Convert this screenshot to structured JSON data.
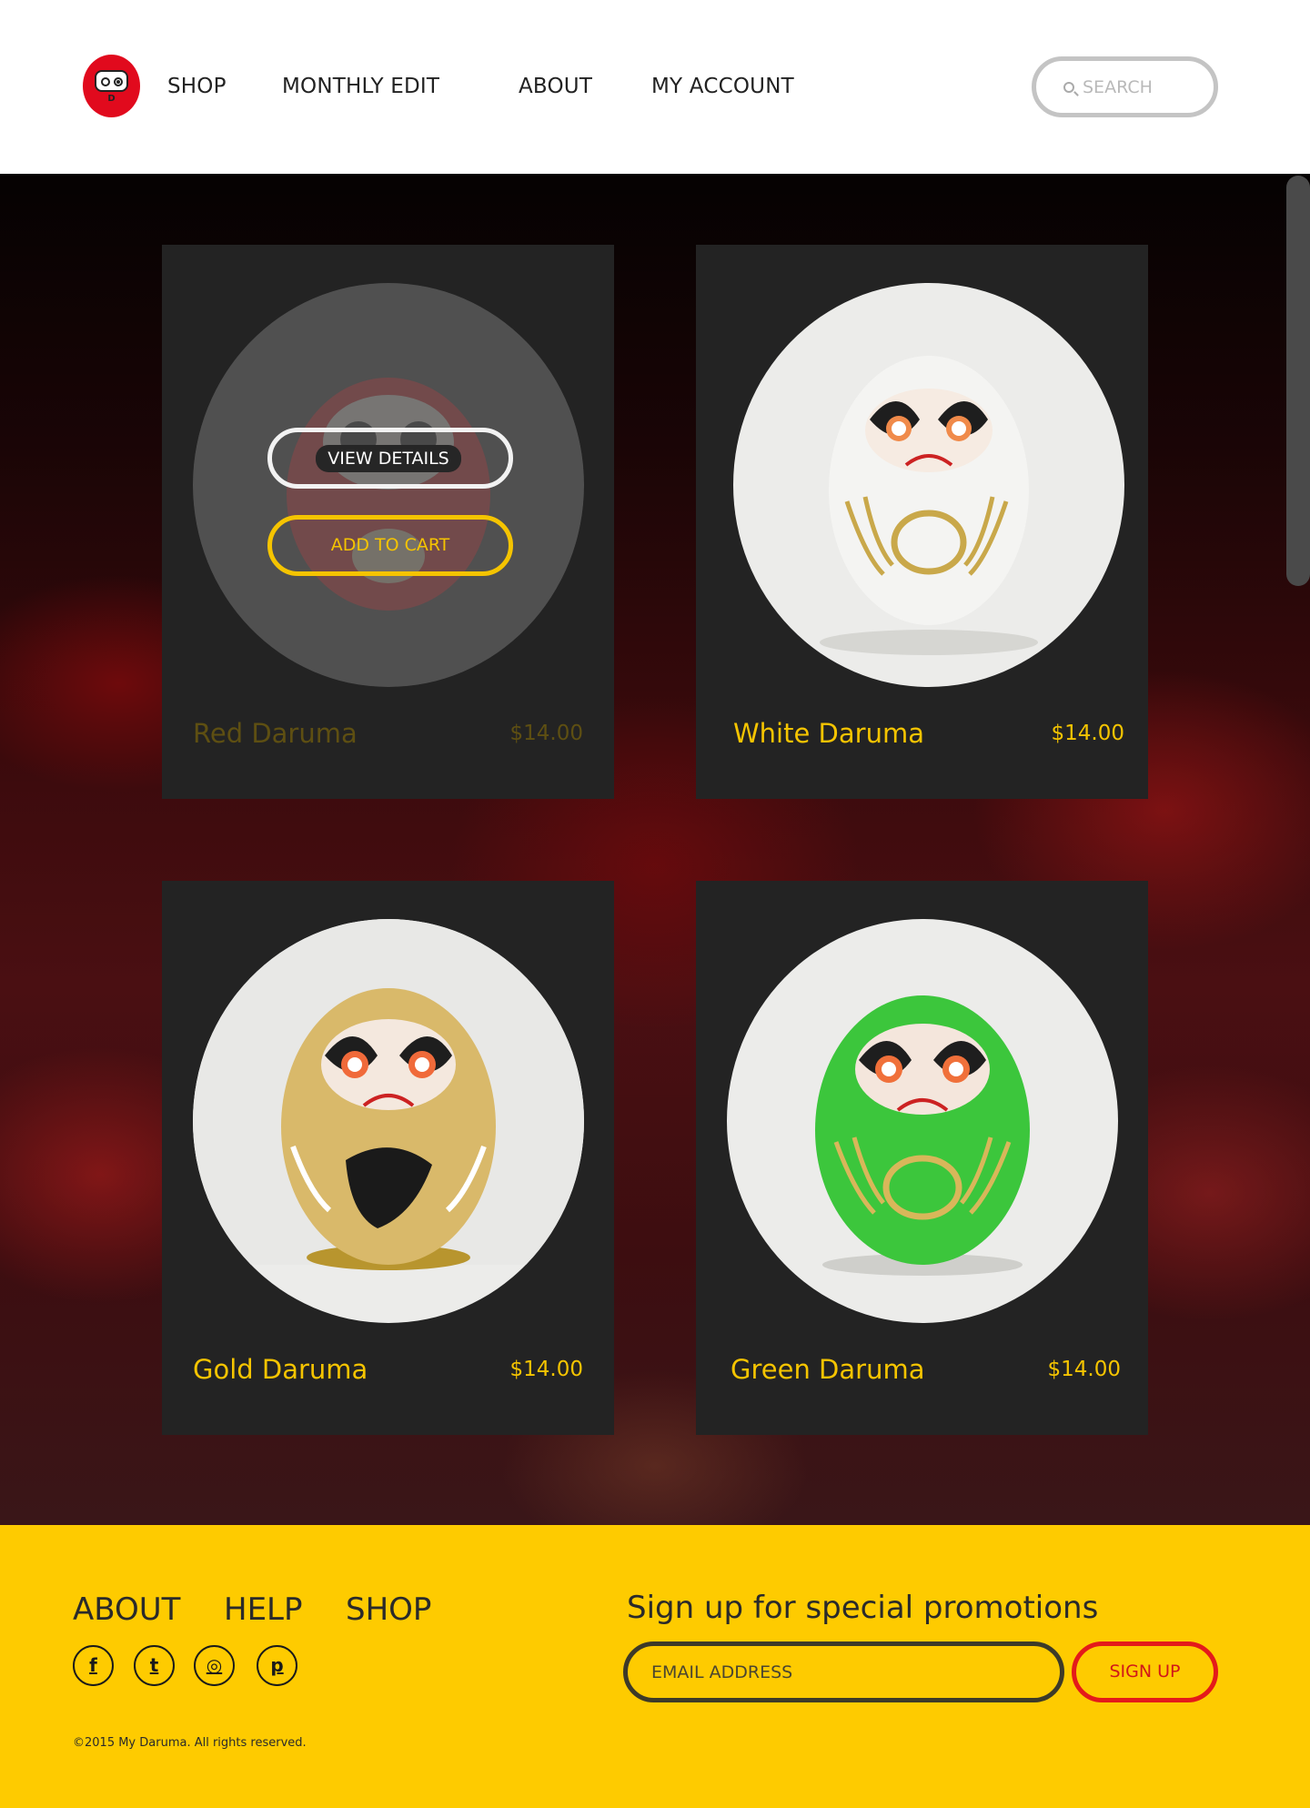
{
  "brand": {
    "logo_letter": "D",
    "accent_color": "#e10a1d"
  },
  "nav": {
    "items": [
      {
        "label": "SHOP"
      },
      {
        "label": "MONTHLY EDIT"
      },
      {
        "label": "ABOUT"
      },
      {
        "label": "MY ACCOUNT"
      }
    ]
  },
  "search": {
    "placeholder": "SEARCH",
    "icon": "search-icon"
  },
  "products": [
    {
      "name": "Red Daruma",
      "price": "$14.00",
      "body_color": "#d8262a",
      "hovered": true
    },
    {
      "name": "White Daruma",
      "price": "$14.00",
      "body_color": "#f4f4f2",
      "hovered": false
    },
    {
      "name": "Gold Daruma",
      "price": "$14.00",
      "body_color": "#d9b96a",
      "hovered": false
    },
    {
      "name": "Green Daruma",
      "price": "$14.00",
      "body_color": "#3cc63c",
      "hovered": false
    }
  ],
  "product_actions": {
    "view_details": "VIEW DETAILS",
    "add_to_cart": "ADD TO CART"
  },
  "footer": {
    "links": [
      {
        "label": "ABOUT"
      },
      {
        "label": "HELP"
      },
      {
        "label": "SHOP"
      }
    ],
    "social": [
      {
        "icon": "facebook-icon",
        "glyph": "f"
      },
      {
        "icon": "twitter-icon",
        "glyph": "t"
      },
      {
        "icon": "instagram-icon",
        "glyph": "◎"
      },
      {
        "icon": "pinterest-icon",
        "glyph": "p"
      }
    ],
    "promo_title": "Sign up for special promotions",
    "email_placeholder": "EMAIL ADDRESS",
    "signup_label": "SIGN UP",
    "copyright": "©2015 My Daruma. All rights reserved.",
    "background": "#fecb00"
  }
}
